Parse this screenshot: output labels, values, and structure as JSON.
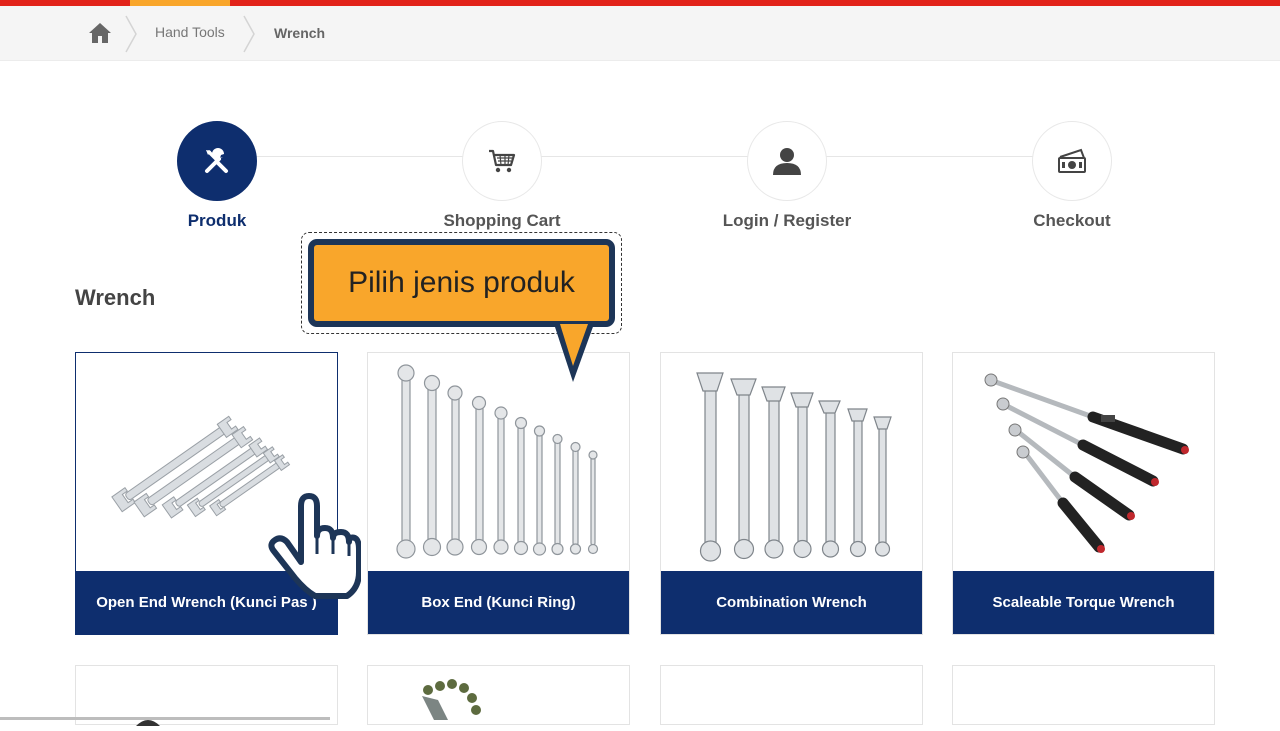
{
  "breadcrumb": {
    "home_icon": "home-icon",
    "items": [
      {
        "label": "Hand Tools"
      },
      {
        "label": "Wrench"
      }
    ]
  },
  "steps": [
    {
      "label": "Produk",
      "icon": "tools-icon",
      "active": true
    },
    {
      "label": "Shopping Cart",
      "icon": "cart-icon",
      "active": false
    },
    {
      "label": "Login / Register",
      "icon": "user-icon",
      "active": false
    },
    {
      "label": "Checkout",
      "icon": "money-icon",
      "active": false
    }
  ],
  "page_title": "Wrench",
  "tooltip": {
    "text": "Pilih jenis produk"
  },
  "products": [
    {
      "name": "Open End Wrench (Kunci Pas )"
    },
    {
      "name": "Box End (Kunci Ring)"
    },
    {
      "name": "Combination Wrench"
    },
    {
      "name": "Scaleable Torque Wrench"
    }
  ],
  "colors": {
    "brand_navy": "#0e2e6e",
    "accent_orange": "#f9a62b",
    "top_red": "#e2231a"
  }
}
